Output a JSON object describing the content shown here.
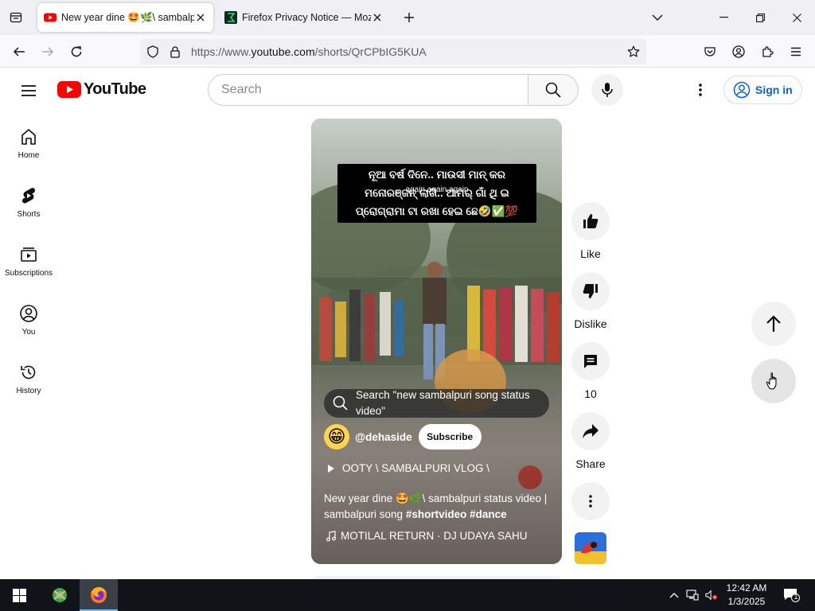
{
  "browser": {
    "tabs": [
      {
        "title": "New year dine 🤩🌿\\ sambalpuri status video",
        "favicon": "youtube-icon",
        "active": true
      },
      {
        "title": "Firefox Privacy Notice — Mozilla",
        "favicon": "mozilla-icon",
        "active": false
      }
    ],
    "url": {
      "prefix": "https://www.",
      "host": "youtube.com",
      "path": "/shorts/QrCPbIG5KUA"
    }
  },
  "youtube": {
    "logo_text": "YouTube",
    "search_placeholder": "Search",
    "sign_in": "Sign in",
    "nav": [
      {
        "label": "Home",
        "icon": "home-icon"
      },
      {
        "label": "Shorts",
        "icon": "shorts-icon"
      },
      {
        "label": "Subscriptions",
        "icon": "subscriptions-icon"
      },
      {
        "label": "You",
        "icon": "you-icon"
      },
      {
        "label": "History",
        "icon": "history-icon"
      }
    ]
  },
  "short": {
    "caption_lines": [
      "ନୂଆ ବର୍ଷ ଦିନେ.. ମାଉସୀ ମାନ୍ କର",
      "ମନୋରଞ୍ଜନ୍ ଲାଗି.. ଆମର୍ ଗାଁ ଥି ଇ",
      "ପ୍ରୋଗ୍ରାମା ଟା ରଖା ହେଇ ଛେ🤣✅💯"
    ],
    "caption_overlay": "again again again",
    "search_suggestion": "Search \"new sambalpuri song status video\"",
    "channel_handle": "@dehaside",
    "avatar_emoji": "😁",
    "subscribe_label": "Subscribe",
    "playlist": "OOTY \\ SAMBALPURI VLOG \\",
    "description_plain": "New year dine 🤩🌿\\ sambalpuri status video | sambalpuri song ",
    "hashtags": [
      "#shortvideo",
      "#dance"
    ],
    "music": "MOTILAL RETURN · DJ UDAYA SAHU"
  },
  "actions": {
    "like": "Like",
    "dislike": "Dislike",
    "comments": "10",
    "share": "Share"
  },
  "taskbar": {
    "time": "12:42 AM",
    "date": "1/3/2025",
    "notification_count": "1"
  }
}
